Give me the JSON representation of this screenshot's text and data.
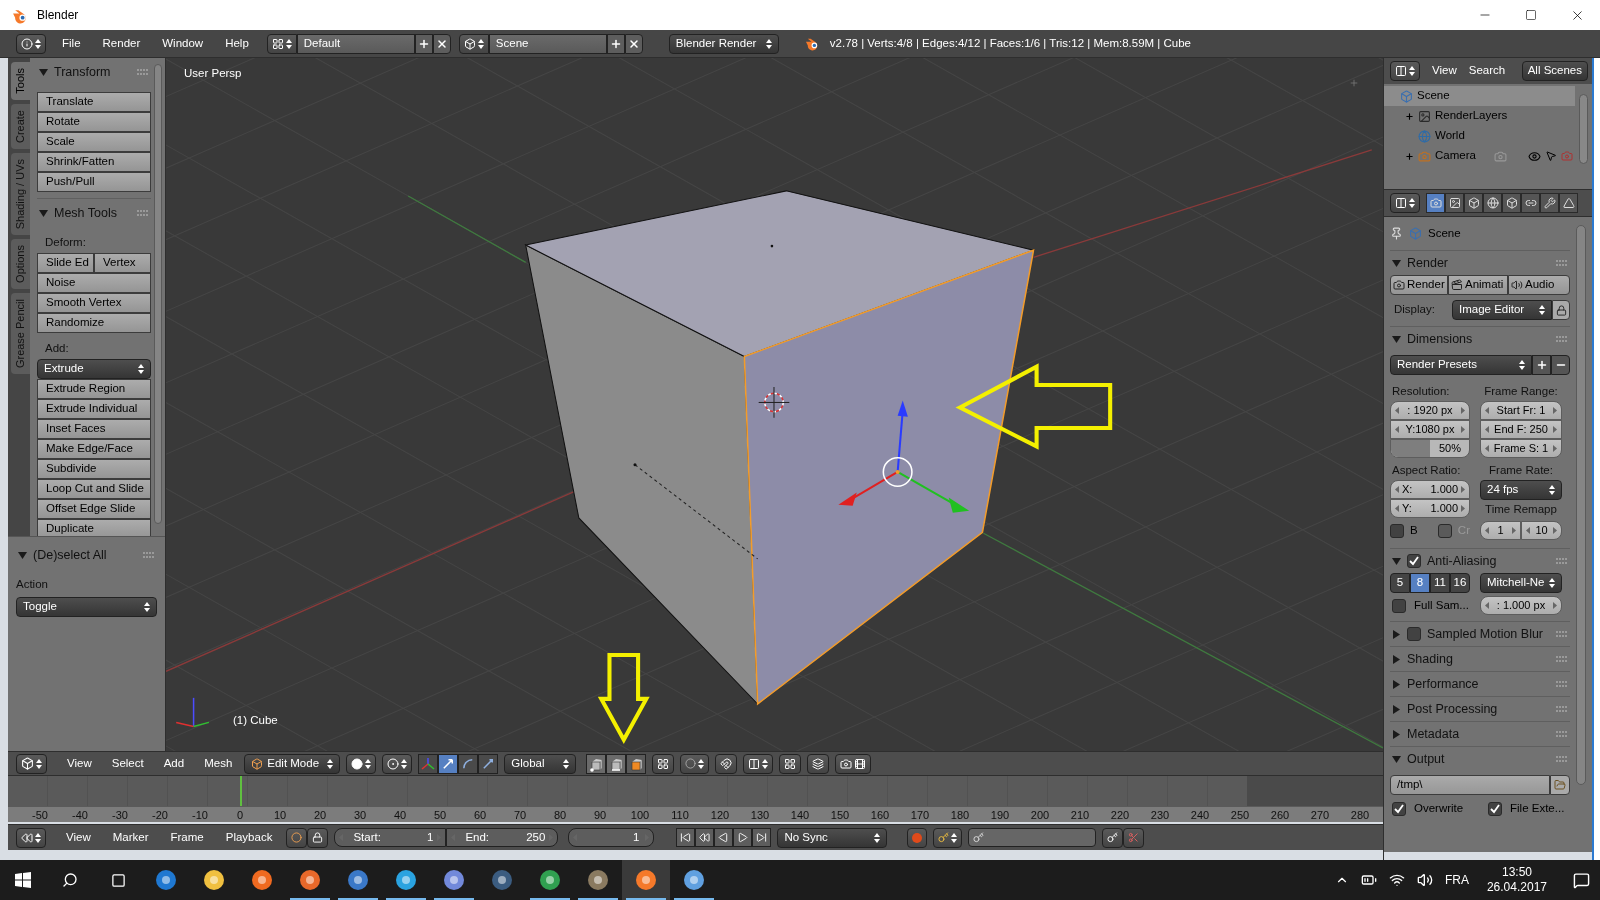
{
  "window": {
    "title": "Blender"
  },
  "info_header": {
    "menus": [
      "File",
      "Render",
      "Window",
      "Help"
    ],
    "screen_layout": "Default",
    "scene": "Scene",
    "render_engine": "Blender Render",
    "stats": "v2.78 | Verts:4/8 | Edges:4/12 | Faces:1/6 | Tris:12 | Mem:8.59M | Cube"
  },
  "tool_shelf": {
    "tabs": [
      {
        "label": "Tools",
        "selected": true
      },
      {
        "label": "Create",
        "selected": false
      },
      {
        "label": "Shading / UVs",
        "selected": false
      },
      {
        "label": "Options",
        "selected": false
      },
      {
        "label": "Grease Pencil",
        "selected": false
      }
    ],
    "panels": [
      {
        "title": "Transform",
        "expanded": true,
        "items": [
          {
            "kind": "button",
            "label": "Translate"
          },
          {
            "kind": "button",
            "label": "Rotate"
          },
          {
            "kind": "button",
            "label": "Scale"
          },
          {
            "kind": "button",
            "label": "Shrink/Fatten"
          },
          {
            "kind": "button",
            "label": "Push/Pull"
          }
        ]
      },
      {
        "title": "Mesh Tools",
        "expanded": true,
        "items": [
          {
            "kind": "label",
            "label": "Deform:"
          },
          {
            "kind": "pair",
            "labels": [
              "Slide Ed",
              "Vertex"
            ]
          },
          {
            "kind": "button",
            "label": "Noise"
          },
          {
            "kind": "button",
            "label": "Smooth Vertex"
          },
          {
            "kind": "button",
            "label": "Randomize"
          },
          {
            "kind": "label",
            "label": "Add:"
          },
          {
            "kind": "dropdown",
            "label": "Extrude"
          },
          {
            "kind": "button",
            "label": "Extrude Region"
          },
          {
            "kind": "button",
            "label": "Extrude Individual"
          },
          {
            "kind": "button",
            "label": "Inset Faces"
          },
          {
            "kind": "button",
            "label": "Make Edge/Face"
          },
          {
            "kind": "button",
            "label": "Subdivide"
          },
          {
            "kind": "button",
            "label": "Loop Cut and Slide"
          },
          {
            "kind": "button",
            "label": "Offset Edge Slide"
          },
          {
            "kind": "button",
            "label": "Duplicate"
          }
        ]
      }
    ]
  },
  "operator_panel": {
    "title": "(De)select All",
    "expanded": true,
    "field_label": "Action",
    "value": "Toggle"
  },
  "viewport": {
    "view_name": "User Persp",
    "object_name": "(1) Cube"
  },
  "viewport_header": {
    "menus": [
      "View",
      "Select",
      "Add",
      "Mesh"
    ],
    "mode": "Edit Mode",
    "manipulators": [
      {
        "kind": "translate",
        "selected": true
      },
      {
        "kind": "rotate",
        "selected": false
      },
      {
        "kind": "scale",
        "selected": false
      }
    ],
    "orientation": "Global",
    "select_modes": [
      {
        "kind": "vertex",
        "selected": false
      },
      {
        "kind": "edge",
        "selected": false
      },
      {
        "kind": "face",
        "selected": true
      }
    ]
  },
  "timeline": {
    "ruler": [
      "-50",
      "-40",
      "-30",
      "-20",
      "-10",
      "0",
      "10",
      "20",
      "30",
      "40",
      "50",
      "60",
      "70",
      "80",
      "90",
      "100",
      "110",
      "120",
      "130",
      "140",
      "150",
      "160",
      "170",
      "180",
      "190",
      "200",
      "210",
      "220",
      "230",
      "240",
      "250",
      "260",
      "270",
      "280"
    ]
  },
  "timeline_header": {
    "menus": [
      "View",
      "Marker",
      "Frame",
      "Playback"
    ],
    "start": {
      "label": "Start:",
      "value": "1"
    },
    "end": {
      "label": "End:",
      "value": "250"
    },
    "current_frame": "1",
    "sync": "No Sync"
  },
  "outliner": {
    "menus": [
      "View",
      "Search"
    ],
    "filter": "All Scenes",
    "tree": [
      {
        "name": "Scene",
        "kind": "scene",
        "selected": true,
        "children": [
          {
            "name": "RenderLayers",
            "kind": "layers",
            "selected": false,
            "expanded": false
          },
          {
            "name": "World",
            "kind": "world",
            "selected": false
          },
          {
            "name": "Camera",
            "kind": "camera",
            "selected": false,
            "expanded": false
          }
        ]
      }
    ]
  },
  "properties": {
    "context_tabs": [
      {
        "kind": "render",
        "selected": true
      },
      {
        "kind": "layers",
        "selected": false
      },
      {
        "kind": "scene",
        "selected": false
      },
      {
        "kind": "world",
        "selected": false
      },
      {
        "kind": "object",
        "selected": false
      },
      {
        "kind": "constraints",
        "selected": false
      },
      {
        "kind": "modifiers",
        "selected": false
      },
      {
        "kind": "data",
        "selected": false
      }
    ],
    "context": "Scene",
    "render": {
      "title": "Render",
      "expanded": true,
      "buttons": [
        "Render",
        "Animati",
        "Audio"
      ],
      "display_label": "Display:",
      "display": "Image Editor"
    },
    "dimensions": {
      "title": "Dimensions",
      "expanded": true,
      "presets": "Render Presets",
      "resolution_label": "Resolution:",
      "resolution_x": ": 1920 px",
      "resolution_y": "Y:1080 px",
      "percentage": {
        "text": "50%",
        "level": 0.5
      },
      "frame_range_label": "Frame Range:",
      "frame_start": "Start Fr: 1",
      "frame_end": "End F: 250",
      "frame_step": "Frame S: 1",
      "aspect_label": "Aspect Ratio:",
      "aspect_x": {
        "axis": "X:",
        "value": "1.000"
      },
      "aspect_y": {
        "axis": "Y:",
        "value": "1.000"
      },
      "frame_rate_label": "Frame Rate:",
      "frame_rate": "24 fps",
      "border": {
        "label": "B",
        "checked": false
      },
      "crop": {
        "label": "Cr",
        "checked": false,
        "disabled": true
      },
      "time_remap_label": "Time Remapp",
      "time_remap": [
        "1",
        "10"
      ]
    },
    "anti_aliasing": {
      "title": "Anti-Aliasing",
      "expanded": true,
      "enabled": true,
      "samples": [
        {
          "label": "5",
          "selected": false
        },
        {
          "label": "8",
          "selected": true
        },
        {
          "label": "11",
          "selected": false
        },
        {
          "label": "16",
          "selected": false
        }
      ],
      "filter": "Mitchell-Ne",
      "full_sample": {
        "label": "Full Sam...",
        "checked": false
      },
      "filter_size": ": 1.000 px"
    },
    "collapsed_panels": [
      {
        "title": "Sampled Motion Blur",
        "expanded": false,
        "kind": "toggle",
        "checked": false
      },
      {
        "title": "Shading",
        "expanded": false,
        "kind": "plain"
      },
      {
        "title": "Performance",
        "expanded": false,
        "kind": "plain"
      },
      {
        "title": "Post Processing",
        "expanded": false,
        "kind": "plain"
      },
      {
        "title": "Metadata",
        "expanded": false,
        "kind": "plain"
      }
    ],
    "output": {
      "title": "Output",
      "expanded": true,
      "path": "/tmp\\",
      "overwrite": {
        "label": "Overwrite",
        "checked": true
      },
      "file_extensions": {
        "label": "File Exte...",
        "checked": true
      }
    }
  },
  "taskbar": {
    "apps": [
      {
        "kind": "edge",
        "running": false,
        "selected": false
      },
      {
        "kind": "explorer",
        "running": false,
        "selected": false
      },
      {
        "kind": "media",
        "running": false,
        "selected": false
      },
      {
        "kind": "firefox",
        "running": true,
        "selected": false
      },
      {
        "kind": "mail",
        "running": true,
        "selected": false
      },
      {
        "kind": "telegram",
        "running": true,
        "selected": false
      },
      {
        "kind": "discord",
        "running": true,
        "selected": false
      },
      {
        "kind": "steam",
        "running": false,
        "selected": false
      },
      {
        "kind": "chrome",
        "running": true,
        "selected": false
      },
      {
        "kind": "gimp",
        "running": true,
        "selected": false
      },
      {
        "kind": "blender",
        "running": true,
        "selected": true
      },
      {
        "kind": "paint",
        "running": true,
        "selected": false
      }
    ],
    "language": "FRA",
    "time": "13:50",
    "date": "26.04.2017"
  }
}
